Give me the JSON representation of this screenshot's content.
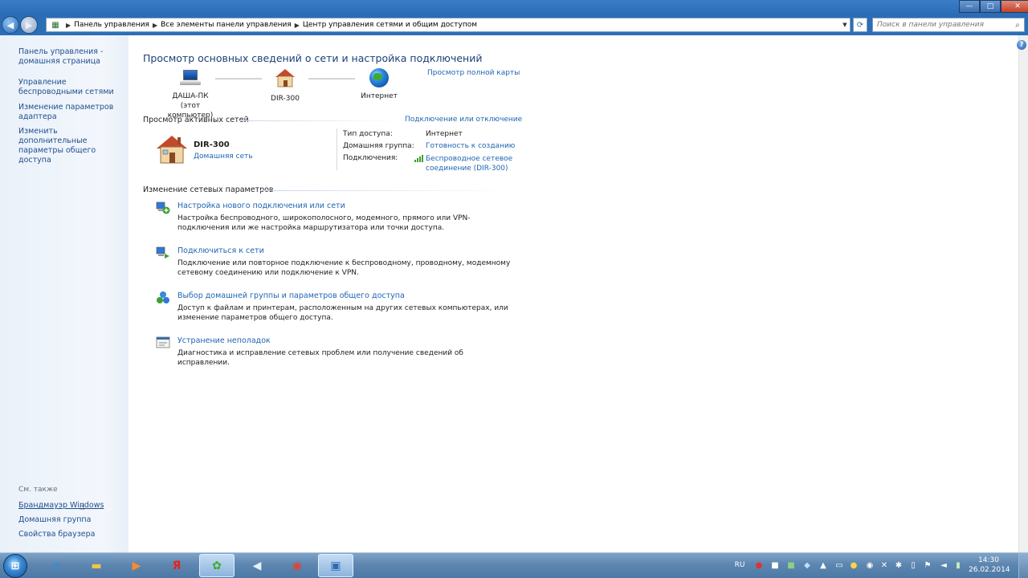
{
  "window": {
    "buttons": {
      "minimize": "—",
      "maximize": "□",
      "close": "✕"
    }
  },
  "address": {
    "breadcrumbs": [
      "Панель управления",
      "Все элементы панели управления",
      "Центр управления сетями и общим доступом"
    ],
    "search_placeholder": "Поиск в панели управления"
  },
  "sidebar": {
    "items": [
      {
        "label": "Панель управления - домашняя страница"
      },
      {
        "label": "Управление беспроводными сетями"
      },
      {
        "label": "Изменение параметров адаптера"
      },
      {
        "label": "Изменить дополнительные параметры общего доступа"
      }
    ],
    "see_also_label": "См. также",
    "see_also": [
      {
        "label": "Брандмауэр Windows"
      },
      {
        "label": "Домашняя группа"
      },
      {
        "label": "Свойства браузера"
      }
    ]
  },
  "main": {
    "heading": "Просмотр основных сведений о сети и настройка подключений",
    "full_map_link": "Просмотр полной карты",
    "map": {
      "computer_name": "ДАША-ПК",
      "computer_sub": "(этот компьютер)",
      "router": "DIR-300",
      "internet": "Интернет"
    },
    "active_networks_title": "Просмотр активных сетей",
    "connect_disconnect_link": "Подключение или отключение",
    "network": {
      "name": "DIR-300",
      "type_link": "Домашняя сеть",
      "access_type_label": "Тип доступа:",
      "access_type_value": "Интернет",
      "homegroup_label": "Домашняя группа:",
      "homegroup_value": "Готовность к созданию",
      "connections_label": "Подключения:",
      "connection_value_line1": "Беспроводное сетевое",
      "connection_value_line2": "соединение (DIR-300)"
    },
    "change_settings_title": "Изменение сетевых параметров",
    "tasks": [
      {
        "title": "Настройка нового подключения или сети",
        "desc": "Настройка беспроводного, широкополосного, модемного, прямого или VPN-подключения или же настройка маршрутизатора или точки доступа."
      },
      {
        "title": "Подключиться к сети",
        "desc": "Подключение или повторное подключение к беспроводному, проводному, модемному сетевому соединению или подключение к VPN."
      },
      {
        "title": "Выбор домашней группы и параметров общего доступа",
        "desc": "Доступ к файлам и принтерам, расположенным на других сетевых компьютерах, или изменение параметров общего доступа."
      },
      {
        "title": "Устранение неполадок",
        "desc": "Диагностика и исправление сетевых проблем или получение сведений об исправлении."
      }
    ]
  },
  "taskbar": {
    "language": "RU",
    "time": "14:30",
    "date": "26.02.2014"
  }
}
